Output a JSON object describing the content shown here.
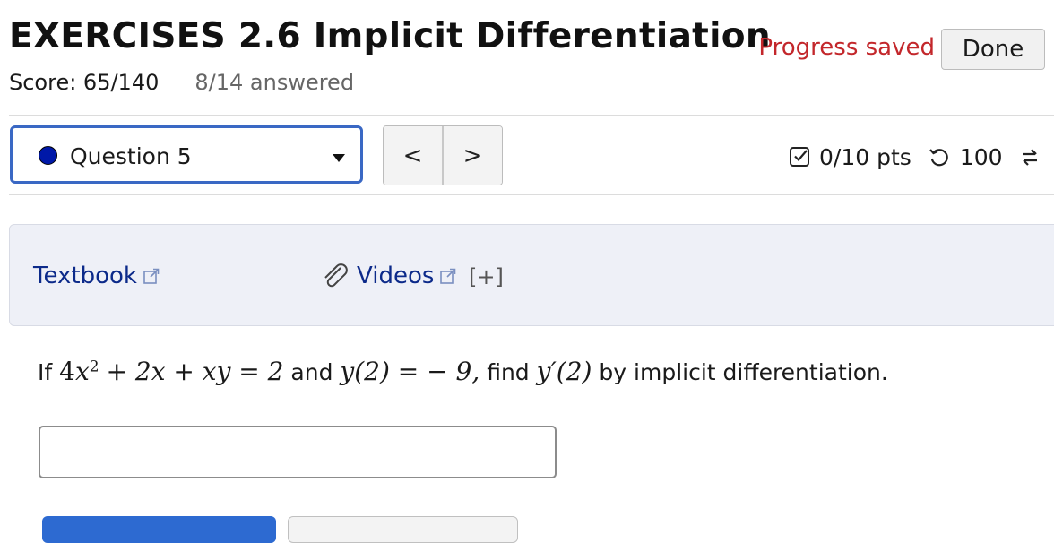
{
  "header": {
    "title": "EXERCISES 2.6 Implicit Differentiation",
    "score": "Score: 65/140",
    "answered": "8/14 answered",
    "progress_text": "Progress saved",
    "done_label": "Done"
  },
  "question_nav": {
    "selected": "Question 5",
    "status_color": "#0018a8",
    "prev_glyph": "<",
    "next_glyph": ">",
    "points": "0/10 pts",
    "attempts": "100"
  },
  "resources": {
    "textbook_label": "Textbook",
    "videos_label": "Videos",
    "expand_label": "[+]"
  },
  "problem": {
    "prefix": "If",
    "equation_coef": "4",
    "equation_var": "x",
    "equation_exp": "2",
    "equation_rest": "+ 2x + xy = 2",
    "conjunction": "and",
    "condition": "y(2) =  − 9,",
    "task_prefix": "find",
    "target": "y′(2)",
    "task_suffix": "by implicit differentiation."
  },
  "answer_field": {
    "value": ""
  },
  "colors": {
    "accent": "#3a68c4",
    "progress": "#c3272b",
    "link": "#0c2a8a",
    "panel_bg": "#eef0f7"
  }
}
